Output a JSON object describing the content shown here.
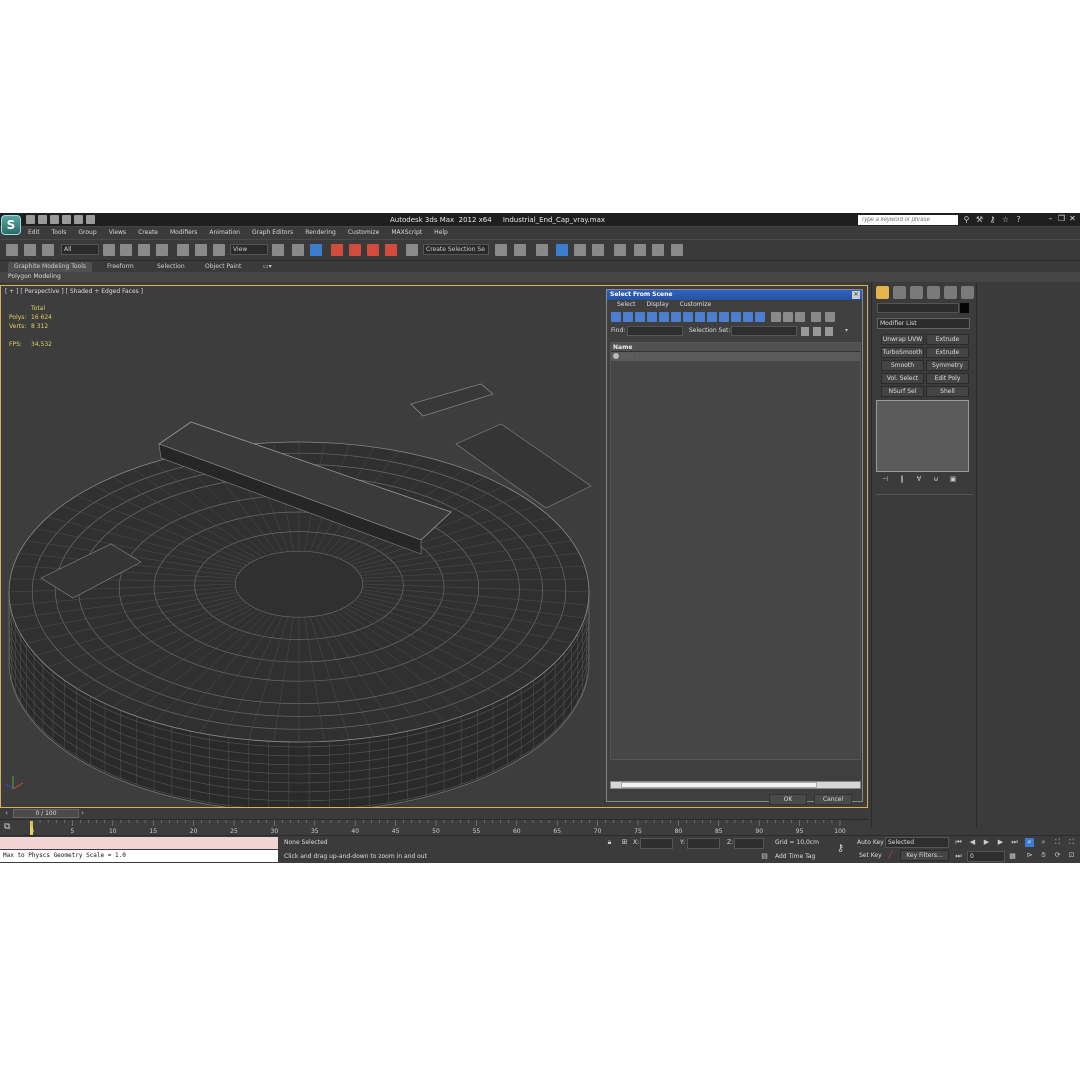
{
  "window": {
    "title": "Autodesk 3ds Max  2012 x64     Industrial_End_Cap_vray.max",
    "search_placeholder": "Type a keyword or phrase",
    "logo": "3ds-max-logo"
  },
  "menu": [
    "Edit",
    "Tools",
    "Group",
    "Views",
    "Create",
    "Modifiers",
    "Animation",
    "Graph Editors",
    "Rendering",
    "Customize",
    "MAXScript",
    "Help"
  ],
  "toolbar": {
    "selection_filter": "All",
    "ref_coord": "View",
    "named_selection_set": "Create Selection Se"
  },
  "ribbon": {
    "tabs": [
      "Graphite Modeling Tools",
      "Freeform",
      "Selection",
      "Object Paint"
    ],
    "active_tab": "Graphite Modeling Tools",
    "panel": "Polygon Modeling"
  },
  "viewport": {
    "label": "[ + ] [ Perspective ] [ Shaded + Edged Faces ]",
    "stats": {
      "total_label": "Total",
      "polys_label": "Polys:",
      "polys": "16 624",
      "verts_label": "Verts:",
      "verts": "8 312",
      "fps_label": "FPS:",
      "fps": "34,532"
    }
  },
  "dialog": {
    "title": "Select From Scene",
    "menu": [
      "Select",
      "Display",
      "Customize"
    ],
    "find_label": "Find:",
    "selection_set_label": "Selection Set:",
    "column_name": "Name",
    "items": [
      "Cap_1"
    ],
    "ok": "OK",
    "cancel": "Cancel"
  },
  "command_panel": {
    "modifier_list": "Modifier List",
    "buttons": [
      [
        "Unwrap UVW",
        "Extrude"
      ],
      [
        "TurboSmooth",
        "Extrude"
      ],
      [
        "Smooth",
        "Symmetry"
      ],
      [
        "Vol. Select",
        "Edit Poly"
      ],
      [
        "NSurf Sel",
        "Shell"
      ]
    ]
  },
  "timeline": {
    "frame_display": "0 / 100",
    "ticks": [
      "0",
      "5",
      "10",
      "15",
      "20",
      "25",
      "30",
      "35",
      "40",
      "45",
      "50",
      "55",
      "60",
      "65",
      "70",
      "75",
      "80",
      "85",
      "90",
      "95",
      "100"
    ]
  },
  "status": {
    "listener_output": "Max to Physcs Geometry Scale = 1.0",
    "selection": "None Selected",
    "prompt": "Click and drag up-and-down to zoom in and out",
    "x_label": "X:",
    "y_label": "Y:",
    "z_label": "Z:",
    "grid": "Grid = 10,0cm",
    "add_time_tag": "Add Time Tag",
    "auto_key": "Auto Key",
    "set_key": "Set Key",
    "key_mode": "Selected",
    "key_filters": "Key Filters...",
    "current_frame": "0"
  }
}
